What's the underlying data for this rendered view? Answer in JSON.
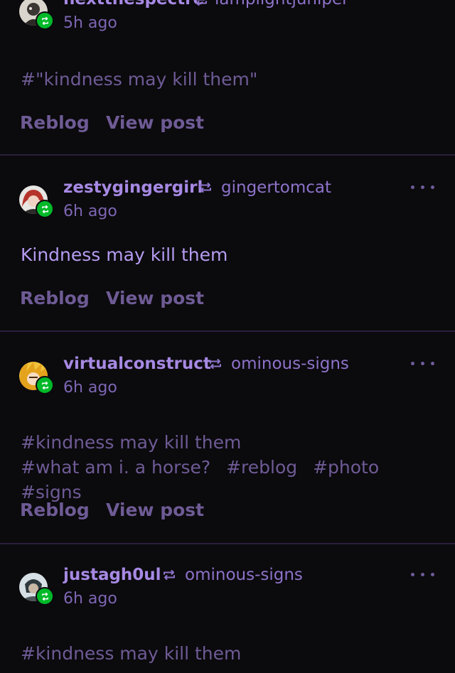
{
  "posts": [
    {
      "author": "nextthespectre",
      "source": "lamplightjuniper",
      "time": "5h ago",
      "avatar": "nextthespectre-avatar",
      "tags": [
        "#\"kindness may kill them\""
      ],
      "reblog_label": "Reblog",
      "view_label": "View post"
    },
    {
      "author": "zestygingergirl",
      "source": "gingertomcat",
      "time": "6h ago",
      "avatar": "zestygingergirl-avatar",
      "body": "Kindness may kill them",
      "reblog_label": "Reblog",
      "view_label": "View post"
    },
    {
      "author": "virtualconstruct",
      "source": "ominous-signs",
      "time": "6h ago",
      "avatar": "virtualconstruct-avatar",
      "tags": [
        "#kindness may kill them",
        "#what am i. a horse?",
        "#reblog",
        "#photo",
        "#signs"
      ],
      "reblog_label": "Reblog",
      "view_label": "View post"
    },
    {
      "author": "justagh0ul",
      "source": "ominous-signs",
      "time": "6h ago",
      "avatar": "justagh0ul-avatar",
      "tags": [
        "#kindness may kill them"
      ]
    }
  ],
  "icons": {
    "reblog": "reblog-icon",
    "more": "more-options-icon"
  },
  "colors": {
    "background": "#0b0a0d",
    "author": "#a689e3",
    "accent": "#b59cf0",
    "muted": "#6e5b95",
    "reblog_badge": "#00b929",
    "divider": "#2a1f3d"
  }
}
